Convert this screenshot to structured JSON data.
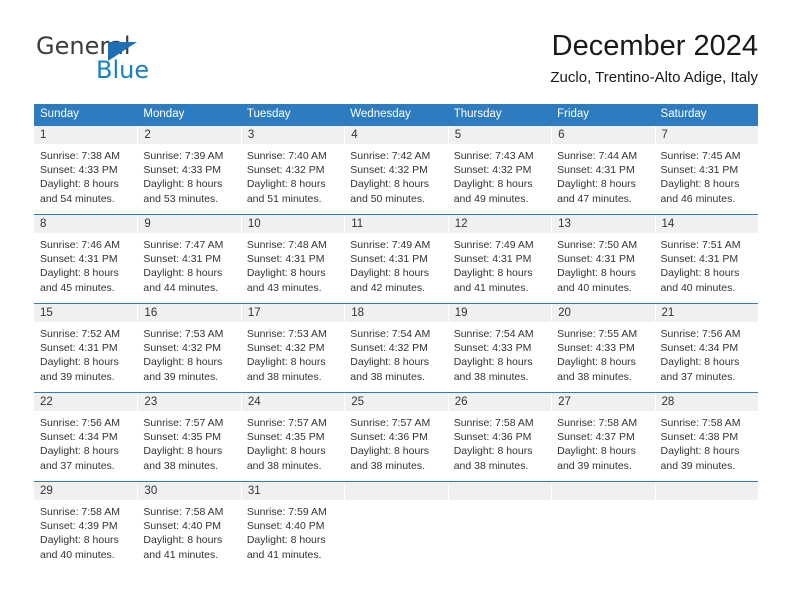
{
  "brand": {
    "name_part1": "General",
    "name_part2": "Blue",
    "accent_color": "#1b7fc4",
    "triangle_color": "#1f6fb4"
  },
  "header": {
    "title": "December 2024",
    "subtitle": "Zuclo, Trentino-Alto Adige, Italy"
  },
  "calendar": {
    "header_bg": "#2e7cc0",
    "daynum_bg": "#f0f0f0",
    "weekdays": [
      "Sunday",
      "Monday",
      "Tuesday",
      "Wednesday",
      "Thursday",
      "Friday",
      "Saturday"
    ],
    "weeks": [
      [
        {
          "day": "1",
          "sunrise": "Sunrise: 7:38 AM",
          "sunset": "Sunset: 4:33 PM",
          "daylight1": "Daylight: 8 hours",
          "daylight2": "and 54 minutes."
        },
        {
          "day": "2",
          "sunrise": "Sunrise: 7:39 AM",
          "sunset": "Sunset: 4:33 PM",
          "daylight1": "Daylight: 8 hours",
          "daylight2": "and 53 minutes."
        },
        {
          "day": "3",
          "sunrise": "Sunrise: 7:40 AM",
          "sunset": "Sunset: 4:32 PM",
          "daylight1": "Daylight: 8 hours",
          "daylight2": "and 51 minutes."
        },
        {
          "day": "4",
          "sunrise": "Sunrise: 7:42 AM",
          "sunset": "Sunset: 4:32 PM",
          "daylight1": "Daylight: 8 hours",
          "daylight2": "and 50 minutes."
        },
        {
          "day": "5",
          "sunrise": "Sunrise: 7:43 AM",
          "sunset": "Sunset: 4:32 PM",
          "daylight1": "Daylight: 8 hours",
          "daylight2": "and 49 minutes."
        },
        {
          "day": "6",
          "sunrise": "Sunrise: 7:44 AM",
          "sunset": "Sunset: 4:31 PM",
          "daylight1": "Daylight: 8 hours",
          "daylight2": "and 47 minutes."
        },
        {
          "day": "7",
          "sunrise": "Sunrise: 7:45 AM",
          "sunset": "Sunset: 4:31 PM",
          "daylight1": "Daylight: 8 hours",
          "daylight2": "and 46 minutes."
        }
      ],
      [
        {
          "day": "8",
          "sunrise": "Sunrise: 7:46 AM",
          "sunset": "Sunset: 4:31 PM",
          "daylight1": "Daylight: 8 hours",
          "daylight2": "and 45 minutes."
        },
        {
          "day": "9",
          "sunrise": "Sunrise: 7:47 AM",
          "sunset": "Sunset: 4:31 PM",
          "daylight1": "Daylight: 8 hours",
          "daylight2": "and 44 minutes."
        },
        {
          "day": "10",
          "sunrise": "Sunrise: 7:48 AM",
          "sunset": "Sunset: 4:31 PM",
          "daylight1": "Daylight: 8 hours",
          "daylight2": "and 43 minutes."
        },
        {
          "day": "11",
          "sunrise": "Sunrise: 7:49 AM",
          "sunset": "Sunset: 4:31 PM",
          "daylight1": "Daylight: 8 hours",
          "daylight2": "and 42 minutes."
        },
        {
          "day": "12",
          "sunrise": "Sunrise: 7:49 AM",
          "sunset": "Sunset: 4:31 PM",
          "daylight1": "Daylight: 8 hours",
          "daylight2": "and 41 minutes."
        },
        {
          "day": "13",
          "sunrise": "Sunrise: 7:50 AM",
          "sunset": "Sunset: 4:31 PM",
          "daylight1": "Daylight: 8 hours",
          "daylight2": "and 40 minutes."
        },
        {
          "day": "14",
          "sunrise": "Sunrise: 7:51 AM",
          "sunset": "Sunset: 4:31 PM",
          "daylight1": "Daylight: 8 hours",
          "daylight2": "and 40 minutes."
        }
      ],
      [
        {
          "day": "15",
          "sunrise": "Sunrise: 7:52 AM",
          "sunset": "Sunset: 4:31 PM",
          "daylight1": "Daylight: 8 hours",
          "daylight2": "and 39 minutes."
        },
        {
          "day": "16",
          "sunrise": "Sunrise: 7:53 AM",
          "sunset": "Sunset: 4:32 PM",
          "daylight1": "Daylight: 8 hours",
          "daylight2": "and 39 minutes."
        },
        {
          "day": "17",
          "sunrise": "Sunrise: 7:53 AM",
          "sunset": "Sunset: 4:32 PM",
          "daylight1": "Daylight: 8 hours",
          "daylight2": "and 38 minutes."
        },
        {
          "day": "18",
          "sunrise": "Sunrise: 7:54 AM",
          "sunset": "Sunset: 4:32 PM",
          "daylight1": "Daylight: 8 hours",
          "daylight2": "and 38 minutes."
        },
        {
          "day": "19",
          "sunrise": "Sunrise: 7:54 AM",
          "sunset": "Sunset: 4:33 PM",
          "daylight1": "Daylight: 8 hours",
          "daylight2": "and 38 minutes."
        },
        {
          "day": "20",
          "sunrise": "Sunrise: 7:55 AM",
          "sunset": "Sunset: 4:33 PM",
          "daylight1": "Daylight: 8 hours",
          "daylight2": "and 38 minutes."
        },
        {
          "day": "21",
          "sunrise": "Sunrise: 7:56 AM",
          "sunset": "Sunset: 4:34 PM",
          "daylight1": "Daylight: 8 hours",
          "daylight2": "and 37 minutes."
        }
      ],
      [
        {
          "day": "22",
          "sunrise": "Sunrise: 7:56 AM",
          "sunset": "Sunset: 4:34 PM",
          "daylight1": "Daylight: 8 hours",
          "daylight2": "and 37 minutes."
        },
        {
          "day": "23",
          "sunrise": "Sunrise: 7:57 AM",
          "sunset": "Sunset: 4:35 PM",
          "daylight1": "Daylight: 8 hours",
          "daylight2": "and 38 minutes."
        },
        {
          "day": "24",
          "sunrise": "Sunrise: 7:57 AM",
          "sunset": "Sunset: 4:35 PM",
          "daylight1": "Daylight: 8 hours",
          "daylight2": "and 38 minutes."
        },
        {
          "day": "25",
          "sunrise": "Sunrise: 7:57 AM",
          "sunset": "Sunset: 4:36 PM",
          "daylight1": "Daylight: 8 hours",
          "daylight2": "and 38 minutes."
        },
        {
          "day": "26",
          "sunrise": "Sunrise: 7:58 AM",
          "sunset": "Sunset: 4:36 PM",
          "daylight1": "Daylight: 8 hours",
          "daylight2": "and 38 minutes."
        },
        {
          "day": "27",
          "sunrise": "Sunrise: 7:58 AM",
          "sunset": "Sunset: 4:37 PM",
          "daylight1": "Daylight: 8 hours",
          "daylight2": "and 39 minutes."
        },
        {
          "day": "28",
          "sunrise": "Sunrise: 7:58 AM",
          "sunset": "Sunset: 4:38 PM",
          "daylight1": "Daylight: 8 hours",
          "daylight2": "and 39 minutes."
        }
      ],
      [
        {
          "day": "29",
          "sunrise": "Sunrise: 7:58 AM",
          "sunset": "Sunset: 4:39 PM",
          "daylight1": "Daylight: 8 hours",
          "daylight2": "and 40 minutes."
        },
        {
          "day": "30",
          "sunrise": "Sunrise: 7:58 AM",
          "sunset": "Sunset: 4:40 PM",
          "daylight1": "Daylight: 8 hours",
          "daylight2": "and 41 minutes."
        },
        {
          "day": "31",
          "sunrise": "Sunrise: 7:59 AM",
          "sunset": "Sunset: 4:40 PM",
          "daylight1": "Daylight: 8 hours",
          "daylight2": "and 41 minutes."
        },
        {
          "day": "",
          "sunrise": "",
          "sunset": "",
          "daylight1": "",
          "daylight2": ""
        },
        {
          "day": "",
          "sunrise": "",
          "sunset": "",
          "daylight1": "",
          "daylight2": ""
        },
        {
          "day": "",
          "sunrise": "",
          "sunset": "",
          "daylight1": "",
          "daylight2": ""
        },
        {
          "day": "",
          "sunrise": "",
          "sunset": "",
          "daylight1": "",
          "daylight2": ""
        }
      ]
    ]
  }
}
